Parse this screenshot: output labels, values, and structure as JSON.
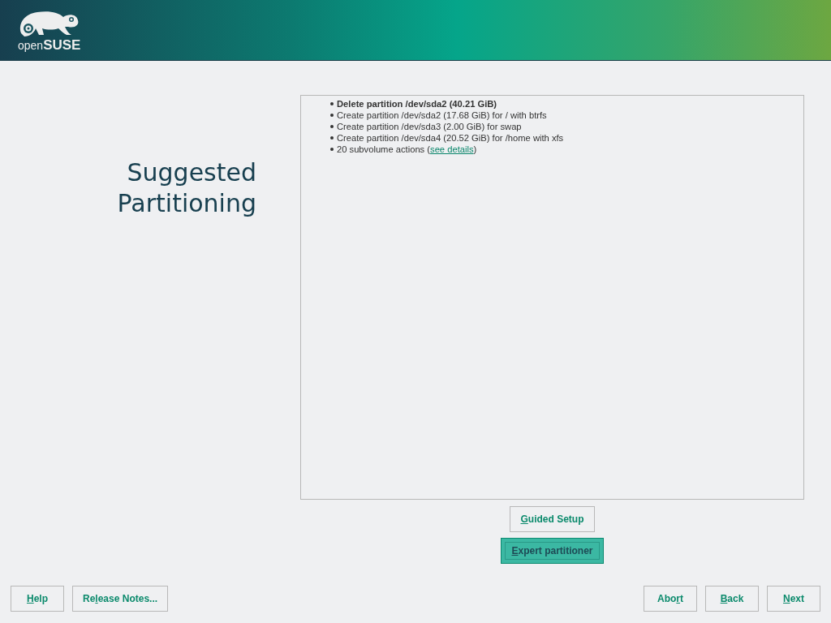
{
  "logo": {
    "prefix": "open",
    "name": "SUSE"
  },
  "title": [
    "Suggested",
    "Partitioning"
  ],
  "actions": [
    {
      "text": "**Delete partition /dev/sda2 (40.21 GiB)**"
    },
    {
      "text": "Create partition /dev/sda2 (17.68 GiB) for / with btrfs"
    },
    {
      "text": "Create partition /dev/sda3 (2.00 GiB) for swap"
    },
    {
      "text": "Create partition /dev/sda4 (20.52 GiB) for /home with xfs"
    },
    {
      "text": "20 subvolume actions (",
      "link": "see details",
      "after": ")"
    }
  ],
  "center_buttons": [
    {
      "key": "G",
      "post": "uided Setup",
      "focused": false
    },
    {
      "key": "E",
      "post": "xpert partitioner",
      "focused": true
    }
  ],
  "left_buttons": [
    {
      "key": "H",
      "post": "elp",
      "focused": false
    },
    {
      "pre": "Re",
      "key": "l",
      "post": "ease Notes...",
      "focused": false
    }
  ],
  "right_buttons": [
    {
      "pre": "Abo",
      "key": "r",
      "post": "t",
      "focused": false
    },
    {
      "key": "B",
      "post": "ack",
      "focused": false
    },
    {
      "key": "N",
      "post": "ext",
      "focused": false
    }
  ]
}
